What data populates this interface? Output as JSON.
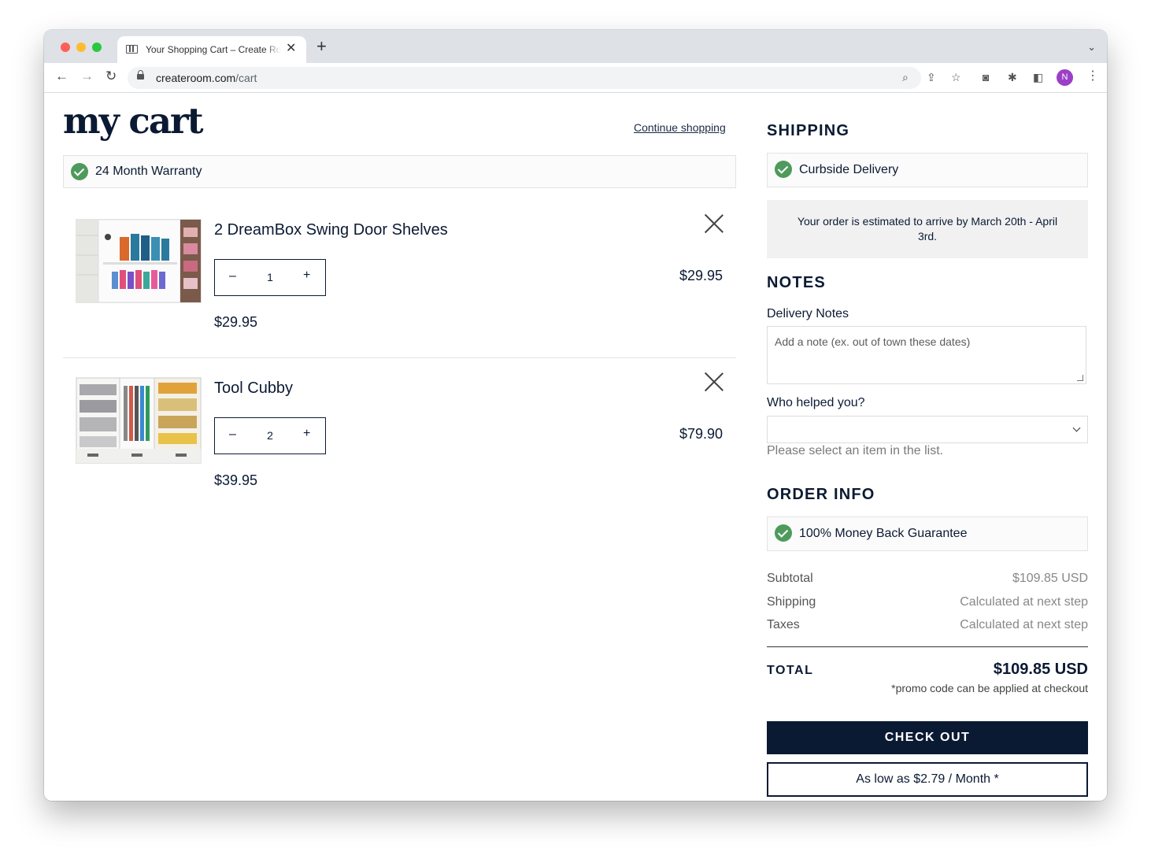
{
  "browser": {
    "tab_title": "Your Shopping Cart – Create Room",
    "tab_close": "✕",
    "new_tab": "+",
    "url_domain": "createroom.com",
    "url_path": "/cart",
    "avatar_initial": "N"
  },
  "header": {
    "brand": "my cart",
    "continue_label": "Continue shopping"
  },
  "warranty": {
    "label": "24 Month Warranty"
  },
  "cart": {
    "items": [
      {
        "name": "2 DreamBox Swing Door Shelves",
        "quantity": "1",
        "unit_price": "$29.95",
        "line_total": "$29.95"
      },
      {
        "name": "Tool Cubby",
        "quantity": "2",
        "unit_price": "$39.95",
        "line_total": "$79.90"
      }
    ],
    "minus_symbol": "–",
    "plus_symbol": "+"
  },
  "shipping": {
    "title": "SHIPPING",
    "method": "Curbside Delivery",
    "estimate": "Your order is estimated to arrive by March 20th - April 3rd."
  },
  "notes": {
    "title": "NOTES",
    "delivery_label": "Delivery Notes",
    "delivery_placeholder": "Add a note (ex. out of town these dates)",
    "helper_label": "Who helped you?",
    "helper_value": "",
    "helper_hint": "Please select an item in the list."
  },
  "order_info": {
    "title": "ORDER INFO",
    "guarantee": "100% Money Back Guarantee",
    "subtotal_label": "Subtotal",
    "subtotal_value": "$109.85 USD",
    "shipping_label": "Shipping",
    "shipping_value": "Calculated at next step",
    "taxes_label": "Taxes",
    "taxes_value": "Calculated at next step",
    "total_label": "TOTAL",
    "total_value": "$109.85 USD",
    "promo_note": "*promo code can be applied at checkout",
    "checkout_label": "CHECK OUT",
    "financing_label": "As low as $2.79 / Month *"
  },
  "colors": {
    "navy": "#0b1a33",
    "check_green": "#4e9a5c"
  }
}
